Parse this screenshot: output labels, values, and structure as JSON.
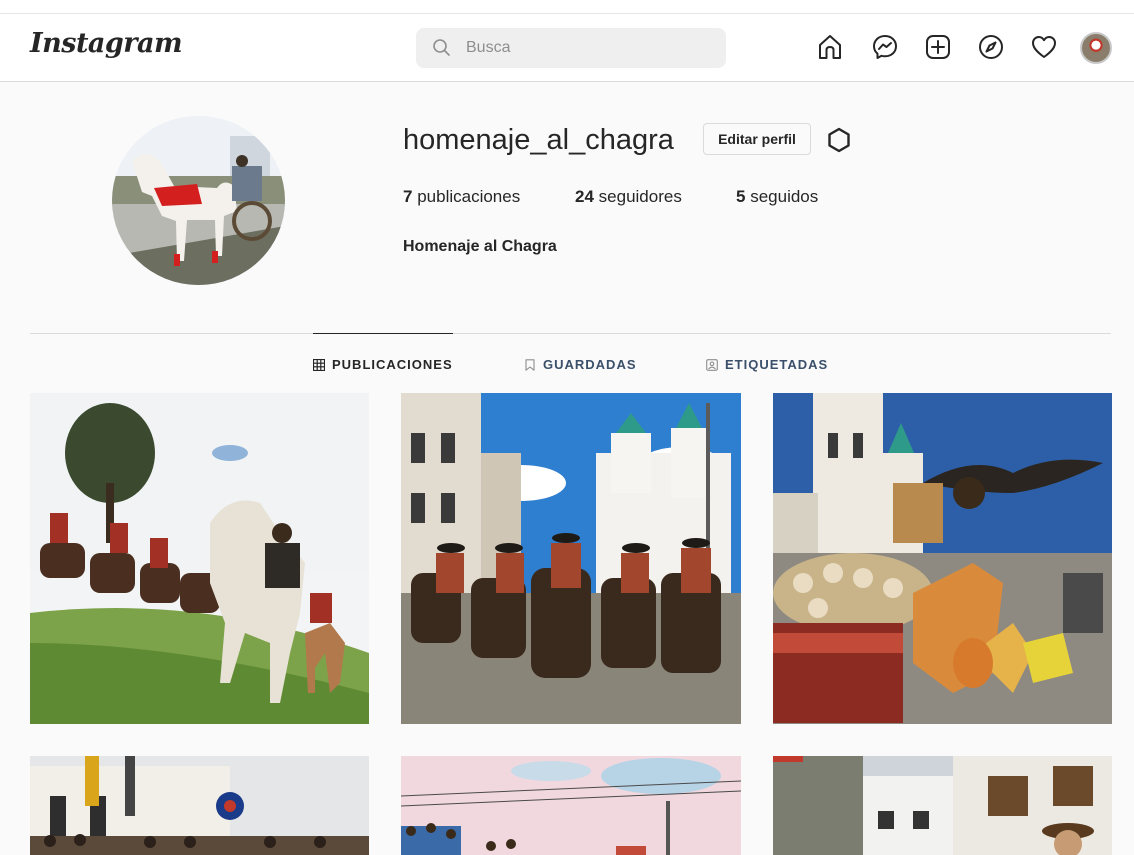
{
  "nav": {
    "logo": "Instagram",
    "search_placeholder": "Busca",
    "icons": [
      "home-icon",
      "messenger-icon",
      "new-post-icon",
      "explore-icon",
      "activity-heart-icon",
      "profile-avatar"
    ]
  },
  "profile": {
    "username": "homenaje_al_chagra",
    "edit_label": "Editar perfil",
    "posts_count": "7",
    "posts_label": "publicaciones",
    "followers_count": "24",
    "followers_label": "seguidores",
    "following_count": "5",
    "following_label": "seguidos",
    "full_name": "Homenaje al Chagra"
  },
  "tabs": [
    {
      "label": "PUBLICACIONES",
      "icon": "grid-icon",
      "active": true
    },
    {
      "label": "GUARDADAS",
      "icon": "bookmark-icon",
      "active": false
    },
    {
      "label": "ETIQUETADAS",
      "icon": "tagged-icon",
      "active": false
    }
  ],
  "posts": [
    {
      "subject": "riders-on-horses-grass-field"
    },
    {
      "subject": "riders-in-plaza-with-church"
    },
    {
      "subject": "parade-float-with-condor"
    },
    {
      "subject": "crowd-at-white-church"
    },
    {
      "subject": "parade-under-pink-sky"
    },
    {
      "subject": "rider-with-hat-street"
    }
  ],
  "colors": {
    "background": "#fafafa",
    "border": "#dbdbdb",
    "text": "#262626",
    "muted": "#8e8e8e"
  }
}
